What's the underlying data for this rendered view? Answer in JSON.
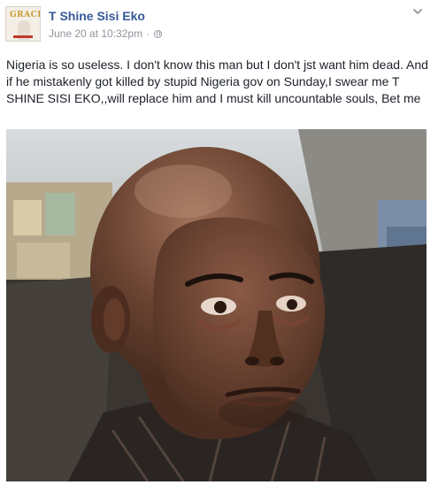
{
  "post": {
    "author_name": "T Shine Sisi Eko",
    "timestamp": "June 20 at 10:32pm",
    "separator": "·",
    "audience_icon": "globe-icon",
    "options_icon": "chevron-down-icon",
    "avatar": {
      "logo_text": "GRACE",
      "bottom_text": "T SHINE"
    },
    "text": "Nigeria is so useless. I don't know this man but I don't jst want him dead. And if he mistakenly got killed by stupid Nigeria gov on Sunday,I swear me T SHINE SISI EKO,,will replace him and I must kill uncountable souls, Bet me",
    "photo_icon": "photo-man-in-car"
  },
  "colors": {
    "author_link": "#365899",
    "meta_text": "#90949c",
    "body_text": "#1d2129"
  }
}
